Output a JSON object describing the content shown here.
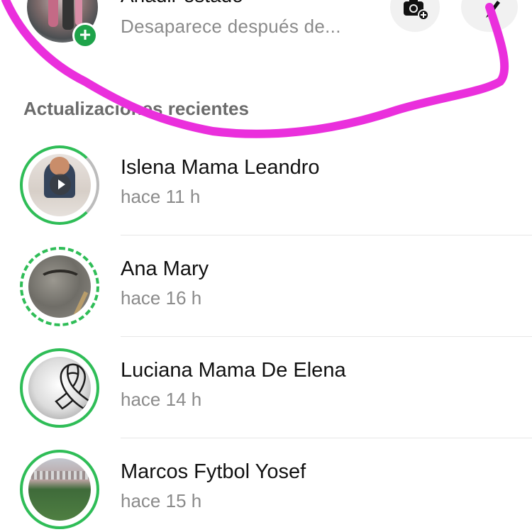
{
  "my_status": {
    "title": "Añadir estado",
    "subtitle": "Desaparece después de...",
    "add_icon": "plus",
    "camera_icon": "camera-plus-icon",
    "pencil_icon": "pencil-icon"
  },
  "section_header": "Actualizaciones recientes",
  "statuses": [
    {
      "name": "Islena Mama Leandro",
      "time": "hace 11 h",
      "ring": "partial"
    },
    {
      "name": "Ana Mary",
      "time": "hace 16 h",
      "ring": "dashed"
    },
    {
      "name": "Luciana Mama De Elena",
      "time": "hace 14 h",
      "ring": "full"
    },
    {
      "name": "Marcos Fytbol Yosef",
      "time": "hace 15 h",
      "ring": "full"
    }
  ],
  "colors": {
    "accent_green": "#2fbd57",
    "annotation_magenta": "#ea2fdc"
  }
}
